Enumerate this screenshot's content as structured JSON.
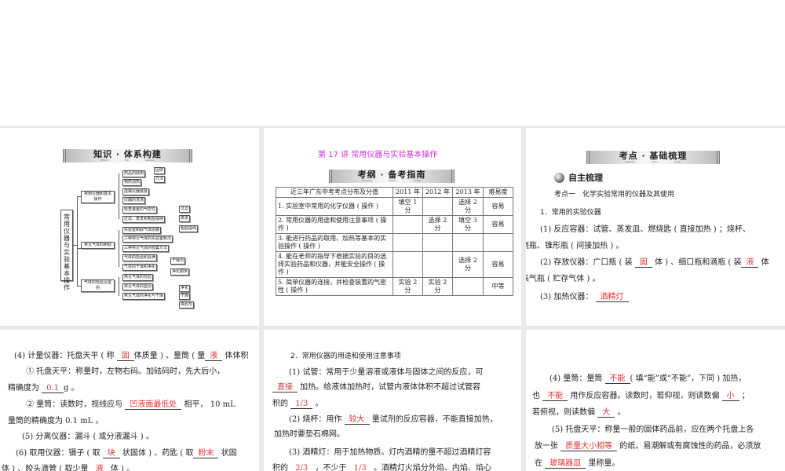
{
  "slide1": {
    "banner": "知识 · 体系构建",
    "pinyin": "ZhiShi TiXi GouJian",
    "root": "常用仪器与实验基本操作",
    "branches": [
      "常用仪器和基本操作",
      "常见气体的制取",
      "气体的检验及鉴别"
    ],
    "leaves1": [
      "药品的取用",
      "物质加热",
      "连接仪器装置",
      "仪器的洗涤",
      "检查装置的气密性",
      "过滤、蒸发和粗盐提纯"
    ],
    "leaves2": [
      "实验室制取气体思路",
      "三种常见气体的实验室制法",
      "三种常见气体的收集方法",
      "气体的检验和验满",
      "气体的干燥和净化"
    ],
    "leaves3": [
      "常见气体的检验",
      "常见气体的鉴别",
      "常见气体的净化与干燥"
    ],
    "sub_take": [
      "固体",
      "方法"
    ],
    "sub_filter": [
      "过滤",
      "蒸发",
      "粗盐提纯"
    ],
    "sub_dry": [
      "干燥剂",
      "净化顺序"
    ],
    "sub_purify": [
      "净化",
      "干燥",
      "吸收剂"
    ]
  },
  "slide2": {
    "title": "第 17 讲  常用仪器与实验基本操作",
    "banner": "考纲 · 备考指南",
    "pinyin": "KaoGang BeiKao ZhiNan",
    "headers": [
      "近三年广东中考考点分布及分值",
      "2011 年",
      "2012 年",
      "2013 年",
      "难易度"
    ],
    "rows": [
      [
        "1. 实验室中常用的化学仪器 ( 操作 )",
        "填空 1 分",
        "",
        "选择 2 分",
        "容易"
      ],
      [
        "2. 常用仪器的用途和使用注意事项 ( 操作 )",
        "",
        "选择 2 分",
        "填空 3 分",
        "容易"
      ],
      [
        "3. 能进行药品的取用、加热等基本的实验操作 ( 操作 )",
        "",
        "",
        "",
        ""
      ],
      [
        "4. 能在老师的指导下根据实验的目的选择实验药品和仪器，并能安全操作 ( 操作 )",
        "",
        "",
        "选择 2 分",
        "容易"
      ],
      [
        "5. 简单仪器的连接，并检查装置的气密性 ( 操作 )",
        "实验 2 分",
        "实验 2 分",
        "",
        "中等"
      ]
    ]
  },
  "slide3": {
    "banner": "考点 · 基础梳理",
    "pinyin": "KaoDian JiChu ShuLi",
    "section": "自主梳理",
    "heading": "考点一　化学实验常用的仪器及其使用",
    "lines": [
      [
        "1．常用的实验仪器"
      ],
      [
        "(1) 反应容器：试管、蒸发皿、燃烧匙 ( 直接加热 ) ；烧杯、"
      ],
      [
        "烧瓶、锥形瓶 ( 间接加热 ) 。"
      ],
      [
        "(2) 存放仪器：广口瓶 ( 装 ",
        {
          "fill": "固"
        },
        " 体 ) 、细口瓶和滴瓶 ( 装",
        {
          "fill": "液"
        },
        " 体"
      ],
      [
        "集气瓶 ( 贮存气体 ) 。"
      ],
      [
        "(3) 加热仪器： ",
        {
          "fill": "酒精灯"
        }
      ]
    ]
  },
  "slide4": {
    "lines": [
      [
        "(4) 计量仪器：托盘天平 ( 称 ",
        {
          "fill": "固"
        },
        "体质量 ) 、量筒 ( 量",
        {
          "fill": "液"
        },
        " 体体积"
      ],
      [
        "① 托盘天平：称量时，左物右码。加砝码时，先大后小，"
      ],
      [
        "精确度为 ",
        {
          "fill": "0.1"
        },
        "g 。"
      ],
      [
        "② 量筒：读数时，视线应与 ",
        {
          "fill": "凹液面最低处"
        },
        " 相平， 10 mL"
      ],
      [
        "量筒的精确度为  0.1 mL 。"
      ],
      [
        "(5) 分离仪器：漏斗 ( 或分液漏斗 ) 。"
      ],
      [
        "(6) 取用仪器：镊子 ( 取 ",
        {
          "fill": "块"
        },
        " 状固体 ) 、药匙 ( 取",
        {
          "fill": "粉末"
        },
        " 状固"
      ],
      [
        "体 ) 、胶头滴管 ( 取少量 ",
        {
          "fill": "液"
        },
        " 体 ) 。"
      ]
    ]
  },
  "slide5": {
    "lines": [
      [
        "2．常用仪器的用途和使用注意事项"
      ],
      [
        "(1) 试管：常用于少量溶液或液体与固体之间的反应，可"
      ],
      [
        {
          "fill": "直接"
        },
        " 加热。给液体加热时，试管内液体体积不超过试管容"
      ],
      [
        "积的 ",
        {
          "fill": "1/3"
        },
        " 。"
      ],
      [
        "(2) 烧杯：用作 ",
        {
          "fill": "较大"
        },
        " 量试剂的反应容器，不能直接加热，"
      ],
      [
        "加热时要垫石棉网。"
      ],
      [
        "(3) 酒精灯：用于加热物质。灯内酒精的量不超过酒精灯容"
      ],
      [
        "积的 ",
        {
          "fill": "2/3"
        },
        " ，不少于 ",
        {
          "fill": "1/3"
        },
        " 。酒精灯火焰分外焰、内焰、焰心"
      ]
    ]
  },
  "slide6": {
    "lines": [
      [
        "(4) 量筒：量筒 ",
        {
          "fill": "不能"
        },
        "( 填“能”或“不能”，下同 ) 加热，"
      ],
      [
        "也 ",
        {
          "fill": "不能"
        },
        " 用作反应容器。读数时，若仰视，则读数偏 ",
        {
          "fill": "小"
        },
        " ；"
      ],
      [
        "若俯视，则读数偏 ",
        {
          "fill": "大"
        },
        " 。"
      ],
      [
        "(5) 托盘天平：称量一般的固体药品前，应在两个托盘上各"
      ],
      [
        "放一张 ",
        {
          "fill": "质量大小相等"
        },
        " 的纸。易潮解或有腐蚀性的药品，必须放"
      ],
      [
        "在 ",
        {
          "fill": "玻璃器皿"
        },
        " 里称量。"
      ]
    ]
  }
}
